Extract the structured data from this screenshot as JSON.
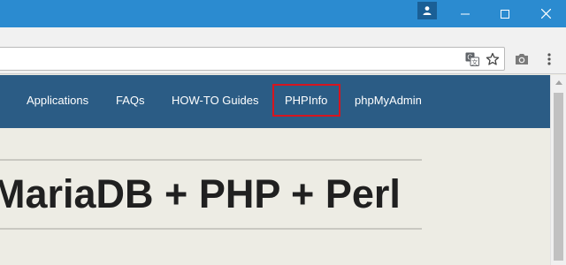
{
  "window": {
    "controls": {
      "minimize": "minimize-icon",
      "maximize": "maximize-icon",
      "close": "close-icon"
    },
    "profile_icon": "user-icon"
  },
  "toolbar": {
    "icons": [
      "translate-icon",
      "star-icon",
      "camera-icon",
      "menu-icon"
    ]
  },
  "nav": {
    "items": [
      {
        "label": "Applications"
      },
      {
        "label": "FAQs"
      },
      {
        "label": "HOW-TO Guides"
      },
      {
        "label": "PHPInfo",
        "highlighted": true
      },
      {
        "label": "phpMyAdmin"
      }
    ]
  },
  "main": {
    "heading": "MariaDB + PHP + Perl"
  },
  "colors": {
    "titlebar": "#2b8bd0",
    "navbar": "#2b5c85",
    "page_bg": "#edece4",
    "highlight_border": "#d6151f"
  }
}
